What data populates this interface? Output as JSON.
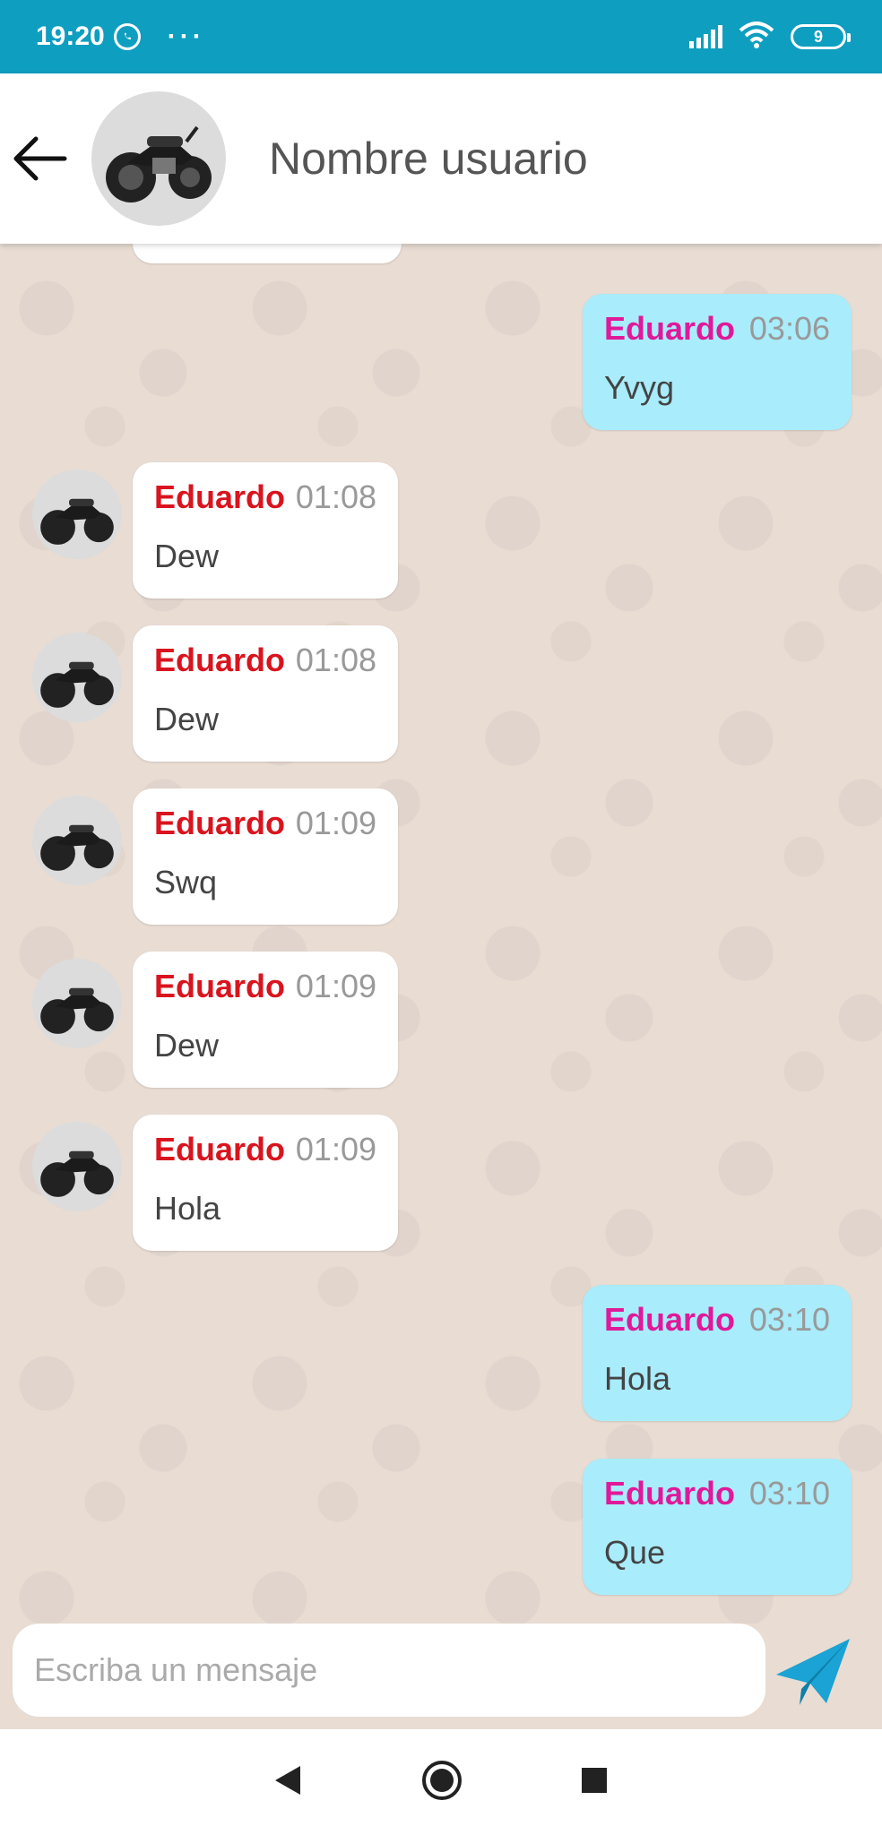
{
  "status_bar": {
    "time": "19:20",
    "more": "···",
    "battery": "9"
  },
  "header": {
    "title": "Nombre usuario"
  },
  "messages": [
    {
      "direction": "out",
      "sender": "Eduardo",
      "time": "03:06",
      "text": "Yvyg"
    },
    {
      "direction": "in",
      "sender": "Eduardo",
      "time": "01:08",
      "text": "Dew"
    },
    {
      "direction": "in",
      "sender": "Eduardo",
      "time": "01:08",
      "text": "Dew"
    },
    {
      "direction": "in",
      "sender": "Eduardo",
      "time": "01:09",
      "text": "Swq"
    },
    {
      "direction": "in",
      "sender": "Eduardo",
      "time": "01:09",
      "text": "Dew"
    },
    {
      "direction": "in",
      "sender": "Eduardo",
      "time": "01:09",
      "text": "Hola"
    },
    {
      "direction": "out",
      "sender": "Eduardo",
      "time": "03:10",
      "text": "Hola"
    },
    {
      "direction": "out",
      "sender": "Eduardo",
      "time": "03:10",
      "text": "Que"
    }
  ],
  "composer": {
    "placeholder": "Escriba un mensaje"
  },
  "colors": {
    "status_bar": "#0e9ec0",
    "incoming_sender": "#d9141e",
    "outgoing_sender": "#e0199a",
    "outgoing_bubble": "#a9ecfb",
    "send_icon": "#1aa3d4"
  },
  "icons": {
    "back": "arrow-left-icon",
    "send": "paper-plane-icon",
    "whatsapp": "whatsapp-icon",
    "signal": "signal-icon",
    "wifi": "wifi-icon",
    "battery": "battery-icon",
    "nav_back": "triangle-back-icon",
    "nav_home": "circle-home-icon",
    "nav_recents": "square-recents-icon"
  }
}
